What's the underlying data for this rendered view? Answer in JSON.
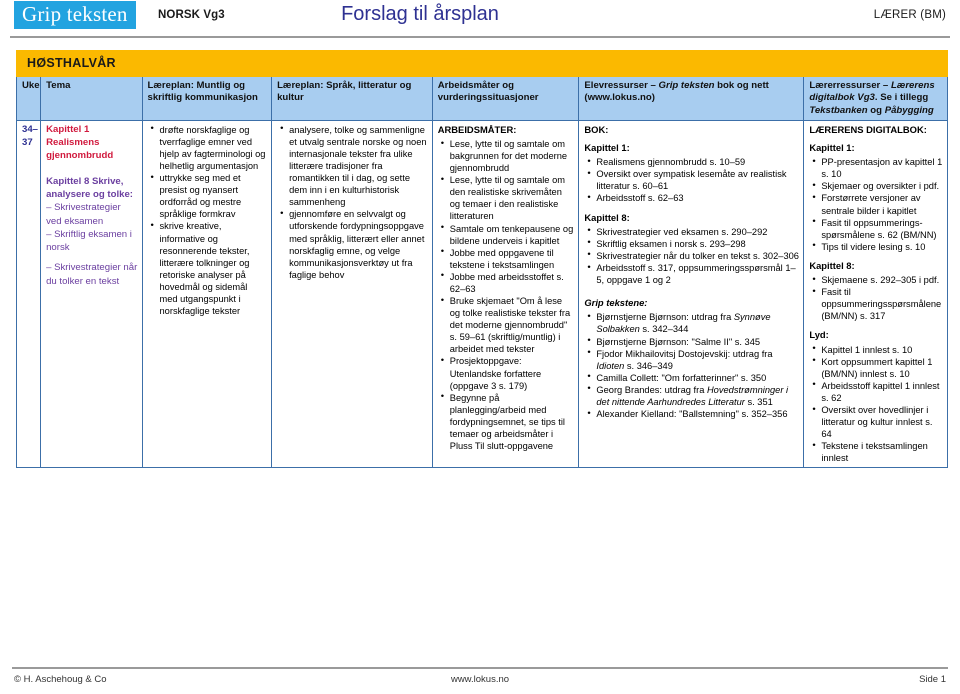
{
  "header": {
    "logo_text": "Grip teksten",
    "subject": "NORSK Vg3",
    "title": "Forslag til årsplan",
    "role": "LÆRER (BM)"
  },
  "season_banner": "HØSTHALVÅR",
  "columns": {
    "uke": "Uke",
    "tema": "Tema",
    "lp_muntlig": "Læreplan: Muntlig og skriftlig kommunikasjon",
    "lp_sprak": "Læreplan: Språk, litteratur og kultur",
    "arbeidsmater": "Arbeidsmåter og vurderingssituasjoner",
    "elevressurser_pre": "Elevressurser – ",
    "elevressurser_em": "Grip teksten",
    "elevressurser_post": " bok og nett (www.lokus.no)",
    "laererressurser_pre": "Lærerressurser – ",
    "laererressurser_em1": "Lærerens digitalbok Vg3",
    "laererressurser_mid": ". Se i tillegg ",
    "laererressurser_em2": "Tekstbanken",
    "laererressurser_mid2": " og ",
    "laererressurser_em3": "Påbygging"
  },
  "row": {
    "uke": "34–37",
    "tema": {
      "chapter1": "Kapittel 1 Realismens gjennombrudd",
      "chapter8_head": "Kapittel 8 Skrive, analysere og tolke:",
      "chapter8_items": [
        "– Skrivestrategier ved eksamen",
        "– Skriftlig eksamen i norsk",
        "– Skrivestrategier når du tolker en tekst"
      ]
    },
    "lp_muntlig_items": [
      "drøfte norskfaglige og tverrfaglige emner ved hjelp av fagterminologi og helhetlig argumentasjon",
      "uttrykke seg med et presist og nyansert ordforråd og mestre språklige formkrav",
      "skrive kreative, informative og resonnerende tekster, litterære tolkninger og retoriske analyser på hovedmål og sidemål med utgangspunkt i norskfaglige tekster"
    ],
    "lp_sprak_items": [
      "analysere, tolke og sammenligne et utvalg sentrale norske og noen internasjonale tekster fra ulike litterære tradisjoner fra romantikken til i dag, og sette dem inn i en kulturhistorisk sammenheng",
      "gjennomføre en selvvalgt og utforskende fordypningsoppgave med språklig, litterært eller annet norskfaglig emne, og velge kommunikasjonsverktøy ut fra faglige behov"
    ],
    "arbeidsmater": {
      "heading": "ARBEIDSMÅTER:",
      "items": [
        "Lese, lytte til og samtale om bakgrunnen for det moderne gjennombrudd",
        "Lese, lytte til og samtale om den realistiske skrivemåten og temaer i den realistiske litteraturen",
        "Samtale om tenkepausene og bildene underveis i kapitlet",
        "Jobbe med oppgavene til tekstene i tekstsamlingen",
        "Jobbe med arbeidsstoffet s. 62–63",
        "Bruke skjemaet \"Om å lese og tolke realistiske tekster fra det moderne gjennombrudd\" s. 59–61 (skriftlig/muntlig) i arbeidet med tekster",
        "Prosjektoppgave: Utenlandske forfattere (oppgave 3 s. 179)",
        "Begynne på planlegging/arbeid med fordypningsemnet, se tips til temaer og arbeidsmåter i Pluss Til slutt-oppgavene"
      ]
    },
    "elevressurser": {
      "bok_heading": "BOK:",
      "kapittel1_heading": "Kapittel 1:",
      "kapittel1_items": [
        "Realismens gjennombrudd s. 10–59",
        "Oversikt over sympatisk lesemåte av realistisk litteratur s. 60–61",
        "Arbeidsstoff s. 62–63"
      ],
      "kapittel8_heading": "Kapittel 8:",
      "kapittel8_items": [
        "Skrivestrategier ved eksamen s. 290–292",
        "Skriftlig eksamen i norsk s. 293–298",
        " Skrivestrategier når du tolker en tekst s. 302–306",
        "Arbeidsstoff s. 317, oppsummeringsspørsmål 1–5, oppgave 1 og 2"
      ],
      "grip_heading": "Grip tekstene:",
      "grip_items": [
        {
          "pre": "Bjørnstjerne Bjørnson: utdrag fra ",
          "em": "Synnøve Solbakken",
          "post": " s. 342–344"
        },
        {
          "pre": "Bjørnstjerne Bjørnson: \"Salme II\" s. 345",
          "em": "",
          "post": ""
        },
        {
          "pre": "Fjodor Mikhailovitsj Dostojevskij: utdrag fra ",
          "em": "Idioten",
          "post": " s. 346–349"
        },
        {
          "pre": "Camilla Collett: \"Om forfatterinner\" s. 350",
          "em": "",
          "post": ""
        },
        {
          "pre": "Georg Brandes: utdrag fra ",
          "em": "Hovedstrømninger i det nittende Aarhundredes Litteratur",
          "post": " s. 351"
        },
        {
          "pre": "Alexander Kielland: \"Ballstemning\" s. 352–356",
          "em": "",
          "post": ""
        }
      ]
    },
    "laererressurser": {
      "digitalbok_heading": "LÆRERENS DIGITALBOK:",
      "kapittel1_heading": "Kapittel 1:",
      "kapittel1_items": [
        "PP-presentasjon av kapittel 1 s. 10",
        "Skjemaer og oversikter i pdf.",
        "Forstørrete versjoner av sentrale bilder i kapitlet",
        "Fasit til oppsummerings-spørsmålene s. 62 (BM/NN)",
        "Tips til videre lesing s. 10"
      ],
      "kapittel8_heading": "Kapittel 8:",
      "kapittel8_items": [
        "Skjemaene s. 292–305 i pdf.",
        "Fasit til oppsummeringsspørsmålene (BM/NN) s. 317"
      ],
      "lyd_heading": "Lyd:",
      "lyd_items": [
        "Kapittel 1 innlest s. 10",
        "Kort oppsummert kapittel 1 (BM/NN) innlest s. 10",
        "Arbeidsstoff kapittel 1 innlest s. 62",
        "Oversikt over hovedlinjer i litteratur og kultur innlest s. 64",
        "Tekstene i tekstsamlingen innlest"
      ]
    }
  },
  "footer": {
    "copyright": "© H. Aschehoug & Co",
    "url": "www.lokus.no",
    "page": "Side  1"
  },
  "colors": {
    "logo_bg": "#22a3e0",
    "title": "#2e3192",
    "banner": "#fbb900",
    "header_row": "#a8cdf0",
    "tema_red": "#d11a3e",
    "tema_purple": "#6b3fa0",
    "border": "#3c6fa8"
  }
}
